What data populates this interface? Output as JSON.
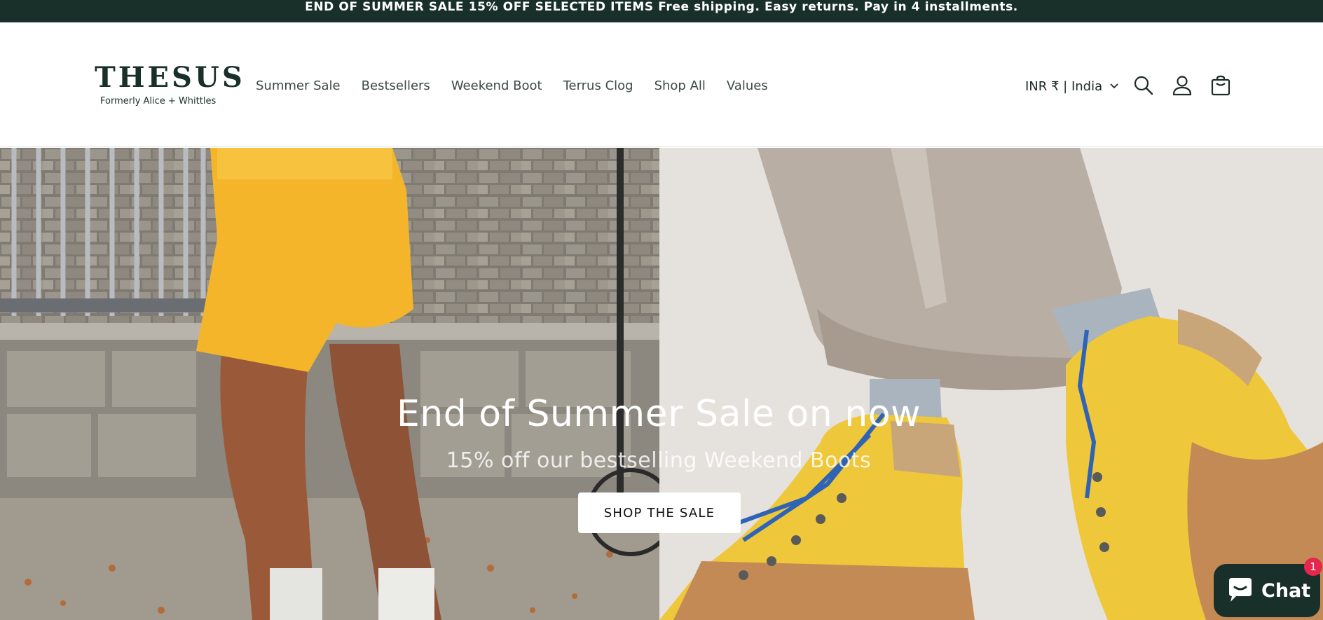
{
  "announcement": {
    "text": "END OF SUMMER SALE 15% OFF SELECTED ITEMS Free shipping. Easy returns. Pay in 4 installments."
  },
  "header": {
    "logo_word": "THESUS",
    "logo_sub": "Formerly Alice + Whittles",
    "nav": [
      {
        "label": "Summer Sale"
      },
      {
        "label": "Bestsellers"
      },
      {
        "label": "Weekend Boot"
      },
      {
        "label": "Terrus Clog"
      },
      {
        "label": "Shop All"
      },
      {
        "label": "Values"
      }
    ],
    "currency": "INR ₹ | India",
    "icons": [
      "search-icon",
      "account-icon",
      "cart-icon"
    ]
  },
  "hero": {
    "title": "End of Summer Sale on now",
    "subtitle": "15% off our bestselling Weekend Boots",
    "button_label": "SHOP THE SALE"
  },
  "chat": {
    "label": "Chat",
    "badge": "1",
    "icon": "chat-bubble-icon"
  },
  "colors": {
    "brand_dark": "#19302a",
    "badge_red": "#e5264d",
    "boot_yellow": "#eec73a",
    "shorts_yellow": "#f4b52a"
  }
}
